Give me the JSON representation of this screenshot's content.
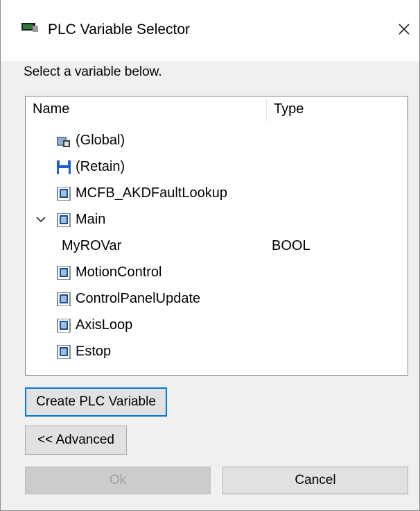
{
  "window": {
    "title": "PLC Variable Selector",
    "close_glyph": "×"
  },
  "instruction": "Select a variable below.",
  "tree": {
    "columns": {
      "name": "Name",
      "type": "Type"
    },
    "rows": [
      {
        "label": "(Global)",
        "type": "",
        "icon": "global-icon"
      },
      {
        "label": "(Retain)",
        "type": "",
        "icon": "floppy-disk-icon"
      },
      {
        "label": "MCFB_AKDFaultLookup",
        "type": "",
        "icon": "program-icon"
      },
      {
        "label": "Main",
        "type": "",
        "icon": "program-icon",
        "expanded": true
      },
      {
        "label": "MyROVar",
        "type": "BOOL",
        "icon": ""
      },
      {
        "label": "MotionControl",
        "type": "",
        "icon": "program-icon"
      },
      {
        "label": "ControlPanelUpdate",
        "type": "",
        "icon": "program-icon"
      },
      {
        "label": "AxisLoop",
        "type": "",
        "icon": "program-icon"
      },
      {
        "label": "Estop",
        "type": "",
        "icon": "program-icon"
      }
    ]
  },
  "buttons": {
    "create": "Create PLC Variable",
    "advanced": "<< Advanced",
    "ok": "Ok",
    "cancel": "Cancel"
  },
  "colors": {
    "focus_border": "#0078d7",
    "retain_icon": "#1f5fd1",
    "window_bg": "#f0f0f0"
  }
}
